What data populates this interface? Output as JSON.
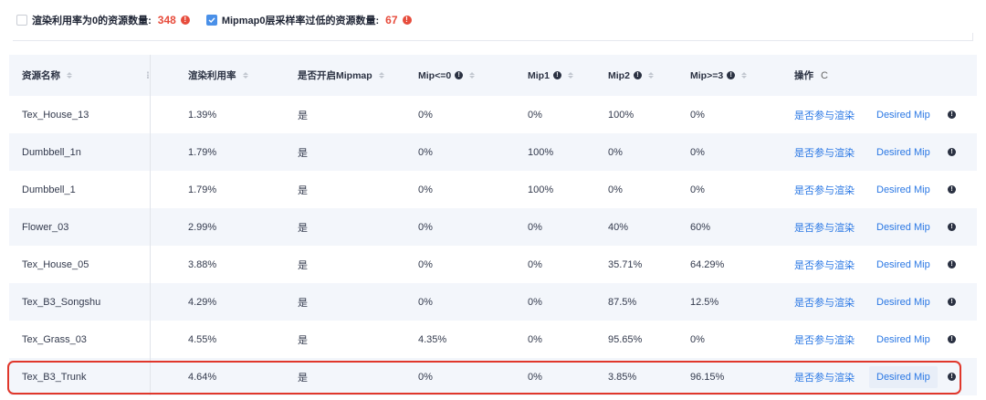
{
  "filters": [
    {
      "label": "渲染利用率为0的资源数量:",
      "count": "348",
      "checked": false
    },
    {
      "label": "Mipmap0层采样率过低的资源数量:",
      "count": "67",
      "checked": true
    }
  ],
  "table": {
    "columns": {
      "name": "资源名称",
      "usage": "渲染利用率",
      "mipmap": "是否开启Mipmap",
      "mip0": "Mip<=0",
      "mip1": "Mip1",
      "mip2": "Mip2",
      "mip3": "Mip>=3",
      "actions": "操作"
    },
    "refresh_icon": "refresh-icon",
    "action_render": "是否参与渲染",
    "action_desired": "Desired Mip",
    "rows": [
      {
        "name": "Tex_House_13",
        "usage": "1.39%",
        "mipmap": "是",
        "mip0": "0%",
        "mip1": "0%",
        "mip2": "100%",
        "mip3": "0%"
      },
      {
        "name": "Dumbbell_1n",
        "usage": "1.79%",
        "mipmap": "是",
        "mip0": "0%",
        "mip1": "100%",
        "mip2": "0%",
        "mip3": "0%"
      },
      {
        "name": "Dumbbell_1",
        "usage": "1.79%",
        "mipmap": "是",
        "mip0": "0%",
        "mip1": "100%",
        "mip2": "0%",
        "mip3": "0%"
      },
      {
        "name": "Flower_03",
        "usage": "2.99%",
        "mipmap": "是",
        "mip0": "0%",
        "mip1": "0%",
        "mip2": "40%",
        "mip3": "60%"
      },
      {
        "name": "Tex_House_05",
        "usage": "3.88%",
        "mipmap": "是",
        "mip0": "0%",
        "mip1": "0%",
        "mip2": "35.71%",
        "mip3": "64.29%"
      },
      {
        "name": "Tex_B3_Songshu",
        "usage": "4.29%",
        "mipmap": "是",
        "mip0": "0%",
        "mip1": "0%",
        "mip2": "87.5%",
        "mip3": "12.5%"
      },
      {
        "name": "Tex_Grass_03",
        "usage": "4.55%",
        "mipmap": "是",
        "mip0": "4.35%",
        "mip1": "0%",
        "mip2": "95.65%",
        "mip3": "0%"
      },
      {
        "name": "Tex_B3_Trunk",
        "usage": "4.64%",
        "mipmap": "是",
        "mip0": "0%",
        "mip1": "0%",
        "mip2": "3.85%",
        "mip3": "96.15%"
      }
    ]
  },
  "colors": {
    "accent": "#2b78e4",
    "warning": "#e74c3c",
    "highlight_border": "#e0372b"
  }
}
